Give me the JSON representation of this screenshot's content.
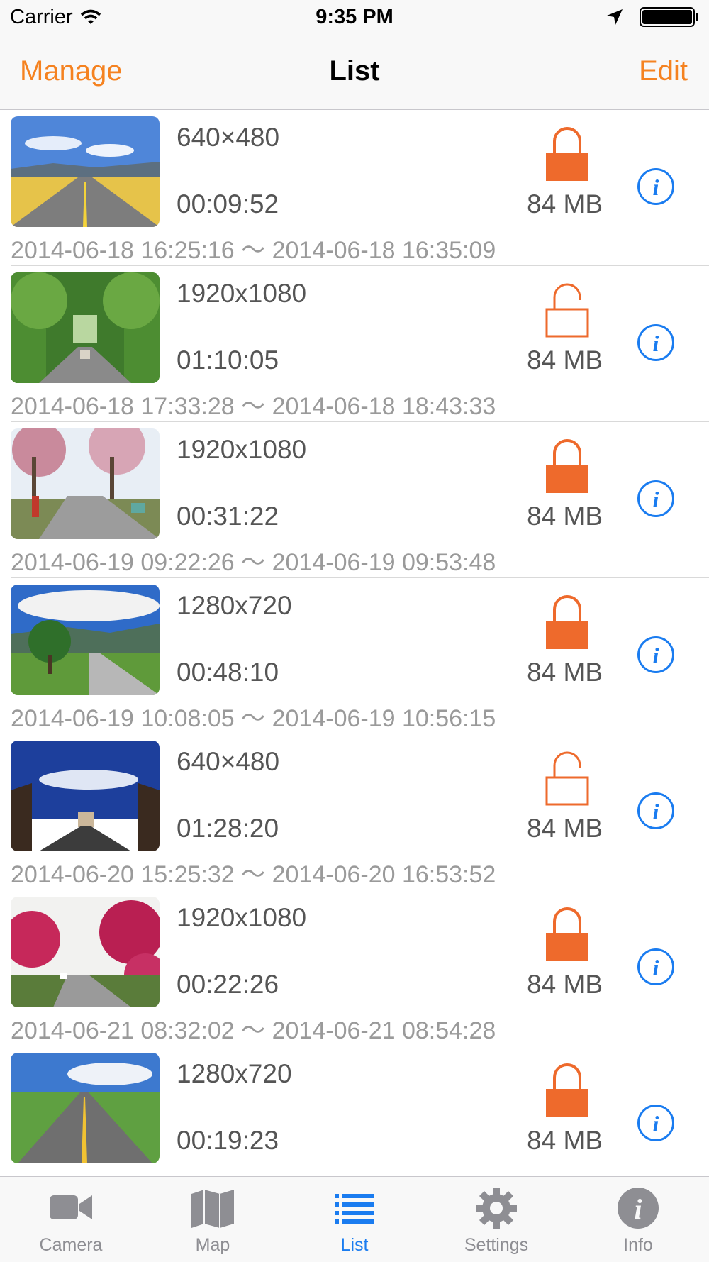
{
  "status_bar": {
    "carrier": "Carrier",
    "time": "9:35 PM"
  },
  "nav": {
    "left": "Manage",
    "title": "List",
    "right": "Edit"
  },
  "items": [
    {
      "resolution": "640×480",
      "duration": "00:09:52",
      "size": "84 MB",
      "locked": true,
      "range": "2014-06-18 16:25:16 ～ 2014-06-18 16:35:09",
      "thumb": "road-field"
    },
    {
      "resolution": "1920x1080",
      "duration": "01:10:05",
      "size": "84 MB",
      "locked": false,
      "range": "2014-06-18 17:33:28 ～ 2014-06-18 18:43:33",
      "thumb": "tree-tunnel"
    },
    {
      "resolution": "1920x1080",
      "duration": "00:31:22",
      "size": "84 MB",
      "locked": true,
      "range": "2014-06-19 09:22:26 ～ 2014-06-19 09:53:48",
      "thumb": "blossom-cyclists"
    },
    {
      "resolution": "1280x720",
      "duration": "00:48:10",
      "size": "84 MB",
      "locked": true,
      "range": "2014-06-19 10:08:05 ～ 2014-06-19 10:56:15",
      "thumb": "lone-tree"
    },
    {
      "resolution": "640×480",
      "duration": "01:28:20",
      "size": "84 MB",
      "locked": false,
      "range": "2014-06-20 15:25:32 ～ 2014-06-20 16:53:52",
      "thumb": "arch-avenue"
    },
    {
      "resolution": "1920x1080",
      "duration": "00:22:26",
      "size": "84 MB",
      "locked": true,
      "range": "2014-06-21 08:32:02 ～ 2014-06-21 08:54:28",
      "thumb": "cherry-road"
    },
    {
      "resolution": "1280x720",
      "duration": "00:19:23",
      "size": "84 MB",
      "locked": true,
      "range": "",
      "thumb": "straight-road"
    }
  ],
  "tabs": [
    {
      "label": "Camera",
      "icon": "video-camera-icon",
      "active": false
    },
    {
      "label": "Map",
      "icon": "map-icon",
      "active": false
    },
    {
      "label": "List",
      "icon": "list-icon",
      "active": true
    },
    {
      "label": "Settings",
      "icon": "gear-icon",
      "active": false
    },
    {
      "label": "Info",
      "icon": "info-icon",
      "active": false
    }
  ],
  "colors": {
    "accent": "#f58220",
    "lock": "#ee6a2c",
    "info": "#1a7cf0",
    "tab_active": "#1a7cf0",
    "tab_inactive": "#8e8e93"
  }
}
